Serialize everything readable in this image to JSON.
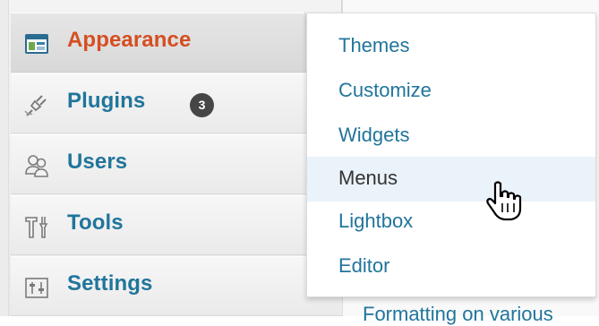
{
  "colors": {
    "link": "#21759b",
    "current": "#d54e21",
    "hover_bg": "#eaf2fa",
    "badge_bg": "#464646"
  },
  "sidebar": {
    "items": [
      {
        "label": "Appearance",
        "icon": "appearance-icon",
        "current": true
      },
      {
        "label": "Plugins",
        "icon": "plugins-icon",
        "badge": "3"
      },
      {
        "label": "Users",
        "icon": "users-icon"
      },
      {
        "label": "Tools",
        "icon": "tools-icon"
      },
      {
        "label": "Settings",
        "icon": "settings-icon"
      }
    ]
  },
  "submenu": {
    "items": [
      {
        "label": "Themes"
      },
      {
        "label": "Customize"
      },
      {
        "label": "Widgets"
      },
      {
        "label": "Menus",
        "hovered": true
      },
      {
        "label": "Lightbox"
      },
      {
        "label": "Editor"
      }
    ]
  },
  "background": {
    "cut_text": "Formatting on various"
  },
  "cursor": {
    "icon": "hand-pointer-icon"
  }
}
